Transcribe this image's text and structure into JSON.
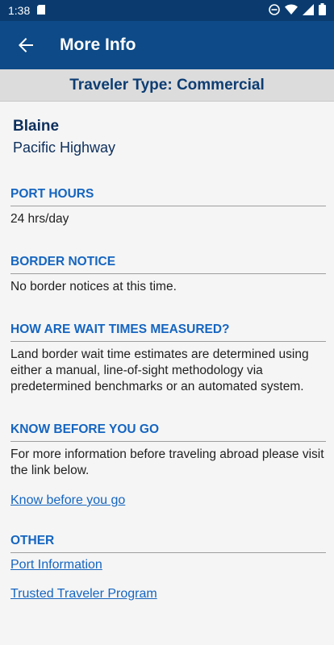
{
  "status_bar": {
    "time": "1:38",
    "icons": [
      "sd-card-icon",
      "do-not-disturb-icon",
      "wifi-icon",
      "signal-icon",
      "battery-icon"
    ]
  },
  "app_bar": {
    "title": "More Info",
    "back_icon": "arrow-left-icon"
  },
  "banner": {
    "label": "Traveler Type: Commercial"
  },
  "port": {
    "name": "Blaine",
    "crossing": "Pacific Highway"
  },
  "sections": {
    "port_hours": {
      "heading": "PORT HOURS",
      "text": "24 hrs/day"
    },
    "border_notice": {
      "heading": "BORDER NOTICE",
      "text": "No border notices at this time."
    },
    "wait_times": {
      "heading": "HOW ARE WAIT TIMES MEASURED?",
      "text": "Land border wait time estimates are determined using either a manual, line-of-sight methodology via predetermined benchmarks or an automated system."
    },
    "know_before": {
      "heading": "KNOW BEFORE YOU GO",
      "text": "For more information before traveling abroad please visit the link below.",
      "link": "Know before you go"
    },
    "other": {
      "heading": "OTHER",
      "links": [
        "Port Information",
        "Trusted Traveler Program"
      ]
    }
  },
  "colors": {
    "status_bar": "#0b3b6e",
    "app_bar": "#0d4a87",
    "heading": "#1565c0",
    "banner_text": "#0d3d73"
  }
}
